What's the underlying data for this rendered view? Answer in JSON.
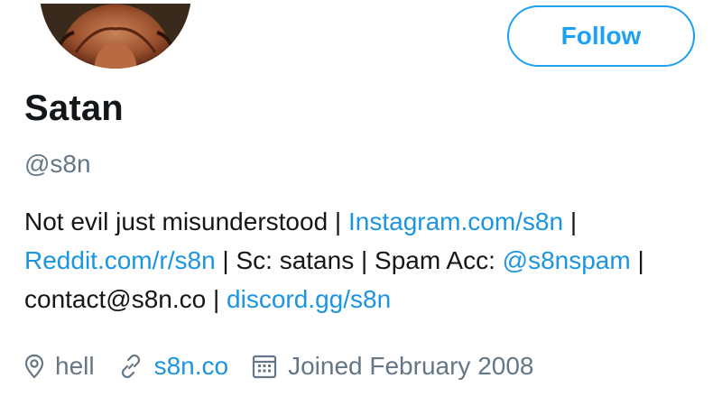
{
  "profile": {
    "display_name": "Satan",
    "handle": "@s8n",
    "follow_label": "Follow"
  },
  "bio": {
    "text_1": "Not evil just misunderstood | ",
    "link_instagram": "Instagram.com/s8n",
    "sep_1": " | ",
    "link_reddit": "Reddit.com/r/s8n",
    "text_2": " | Sc: satans | Spam Acc: ",
    "link_spam": "@s8nspam",
    "text_3": " | contact@s8n.co | ",
    "link_discord": "discord.gg/s8n"
  },
  "meta": {
    "location": "hell",
    "website": "s8n.co",
    "joined": "Joined February 2008"
  },
  "icons": {
    "location": "location-pin-icon",
    "website": "link-icon",
    "joined": "calendar-icon"
  },
  "colors": {
    "accent": "#1da1f2",
    "link": "#1b95e0",
    "text": "#14171a",
    "secondary": "#657786"
  }
}
